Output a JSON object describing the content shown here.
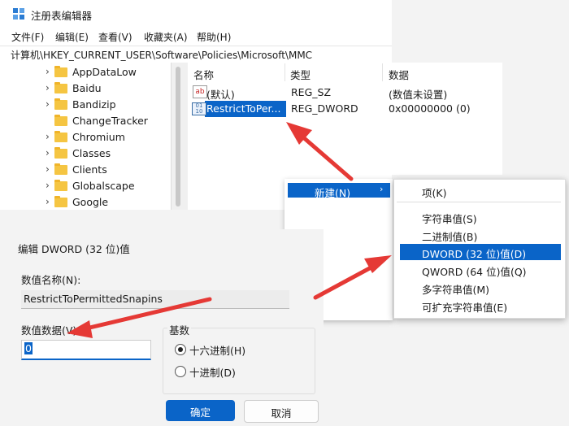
{
  "regedit": {
    "title": "注册表编辑器",
    "menus": [
      "文件(F)",
      "编辑(E)",
      "查看(V)",
      "收藏夹(A)",
      "帮助(H)"
    ],
    "address": "计算机\\HKEY_CURRENT_USER\\Software\\Policies\\Microsoft\\MMC",
    "tree": [
      {
        "label": "AppDataLow",
        "expandable": true
      },
      {
        "label": "Baidu",
        "expandable": true
      },
      {
        "label": "Bandizip",
        "expandable": true
      },
      {
        "label": "ChangeTracker",
        "expandable": false
      },
      {
        "label": "Chromium",
        "expandable": true
      },
      {
        "label": "Classes",
        "expandable": true
      },
      {
        "label": "Clients",
        "expandable": true
      },
      {
        "label": "Globalscape",
        "expandable": true
      },
      {
        "label": "Google",
        "expandable": true
      }
    ],
    "columns": {
      "name": "名称",
      "type": "类型",
      "data": "数据"
    },
    "values": [
      {
        "icon": "string-value-icon",
        "name": "(默认)",
        "type": "REG_SZ",
        "data": "(数值未设置)"
      },
      {
        "icon": "binary-value-icon",
        "name": "RestrictToPer...",
        "type": "REG_DWORD",
        "data": "0x00000000 (0)"
      }
    ]
  },
  "context_menu": {
    "parent_item": "新建(N)",
    "items": [
      "项(K)",
      "字符串值(S)",
      "二进制值(B)",
      "DWORD (32 位)值(D)",
      "QWORD (64 位)值(Q)",
      "多字符串值(M)",
      "可扩充字符串值(E)"
    ],
    "highlighted_index": 3
  },
  "dialog": {
    "title": "编辑 DWORD (32 位)值",
    "name_label": "数值名称(N):",
    "name_value": "RestrictToPermittedSnapins",
    "data_label": "数值数据(V):",
    "data_value": "0",
    "base_label": "基数",
    "base_options": [
      "十六进制(H)",
      "十进制(D)"
    ],
    "base_selected": 0,
    "ok_label": "确定",
    "cancel_label": "取消"
  },
  "colors": {
    "accent": "#0a64c8",
    "arrow": "#e53935"
  }
}
